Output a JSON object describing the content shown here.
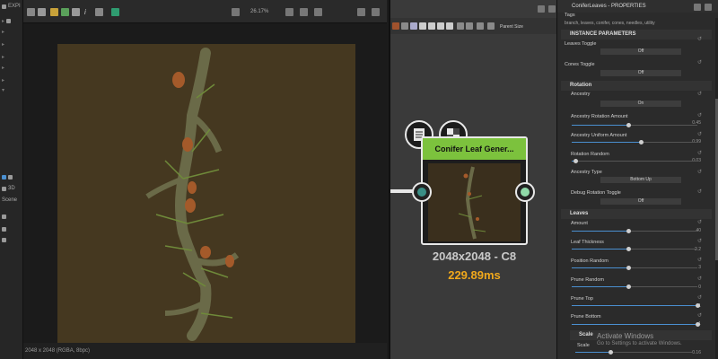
{
  "toolbar": {
    "explorer_label": "EXPI",
    "zoom": "26.17%"
  },
  "left_panel": {
    "view3d_label": "3D",
    "scene_label": "Scene"
  },
  "view2d": {
    "resolution": "2048 x 2048 (RGBA, 8bpc)"
  },
  "graph": {
    "parent_size_label": "Parent Size",
    "node": {
      "title": "Conifer Leaf Gener...",
      "resolution": "2048x2048 - C8",
      "time": "229.89ms",
      "header_color": "#7cc23d",
      "input_port_color": "#3a8f86",
      "output_port_color": "#8fd9a8"
    }
  },
  "properties": {
    "title": "ConiferLeaves - PROPERTIES",
    "tags_label": "Tags",
    "tags_value": "branch, leaves, conifer, cones, needles, utility",
    "sections": {
      "instance": "INSTANCE PARAMETERS",
      "rotation": "Rotation",
      "leaves": "Leaves",
      "scale": "Scale"
    },
    "leaves_toggle": {
      "label": "Leaves Toggle",
      "value": "Off"
    },
    "cones_toggle": {
      "label": "Cones Toggle",
      "value": "Off"
    },
    "ancestry": {
      "label": "Ancestry",
      "value": "On"
    },
    "ancestry_rotation_amount": {
      "label": "Ancestry Rotation Amount",
      "value": "0.45",
      "fraction": 0.45
    },
    "ancestry_uniform_amount": {
      "label": "Ancestry Uniform Amount",
      "value": "0.99",
      "fraction": 0.55
    },
    "rotation_random": {
      "label": "Rotation Random",
      "value": "0.03",
      "fraction": 0.03
    },
    "ancestry_type": {
      "label": "Ancestry Type",
      "value": "Bottom Up"
    },
    "debug_rotation_toggle": {
      "label": "Debug Rotation Toggle",
      "value": "Off"
    },
    "amount": {
      "label": "Amount",
      "value": "40",
      "fraction": 0.45
    },
    "leaf_thickness": {
      "label": "Leaf Thickness",
      "value": "2.2",
      "fraction": 0.45
    },
    "position_random": {
      "label": "Position Random",
      "value": "3",
      "fraction": 0.45
    },
    "prune_random": {
      "label": "Prune Random",
      "value": "0",
      "fraction": 0.45
    },
    "prune_top": {
      "label": "Prune Top",
      "value": "1",
      "fraction": 1.0
    },
    "prune_bottom": {
      "label": "Prune Bottom",
      "value": "1",
      "fraction": 1.0
    },
    "scale": {
      "label": "Scale",
      "value": "0.16",
      "fraction": 0.3
    }
  },
  "windows_notice": {
    "title": "Activate Windows",
    "subtitle": "Go to Settings to activate Windows."
  }
}
